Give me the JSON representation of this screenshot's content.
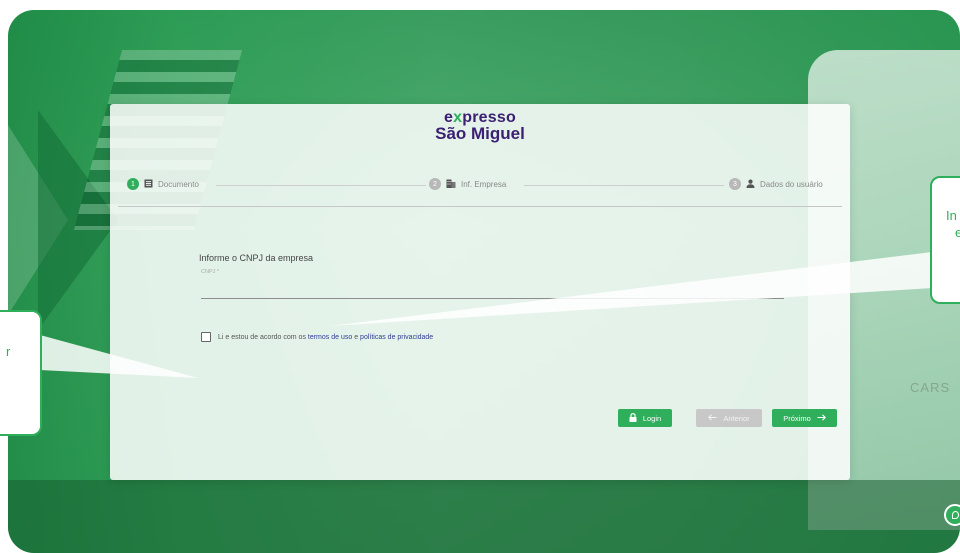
{
  "brand": {
    "logo_line1_a": "e",
    "logo_line1_x": "x",
    "logo_line1_b": "presso",
    "logo_line2": "São Miguel"
  },
  "stepper": {
    "steps": [
      {
        "number": "1",
        "icon": "document-icon",
        "label": "Documento",
        "active": true
      },
      {
        "number": "2",
        "icon": "building-icon",
        "label": "Inf. Empresa",
        "active": false
      },
      {
        "number": "3",
        "icon": "user-icon",
        "label": "Dados do usuário",
        "active": false
      }
    ]
  },
  "form": {
    "title": "Informe o CNPJ da empresa",
    "cnpj_label": "CNPJ *",
    "cnpj_value": ""
  },
  "terms": {
    "prefix": "Li e estou de acordo com os ",
    "terms_link": "termos de uso",
    "and": " e ",
    "privacy_link": "políticas de privacidade"
  },
  "buttons": {
    "login": "Login",
    "previous": "Anterior",
    "next": "Próximo"
  },
  "callouts": {
    "left_text": "r",
    "right_text_1": "In",
    "right_text_2": "e"
  },
  "background": {
    "truck_text": "CARS"
  },
  "colors": {
    "brand_green": "#2fae5c",
    "brand_purple": "#3b1f72",
    "link_blue": "#2f3d96"
  }
}
